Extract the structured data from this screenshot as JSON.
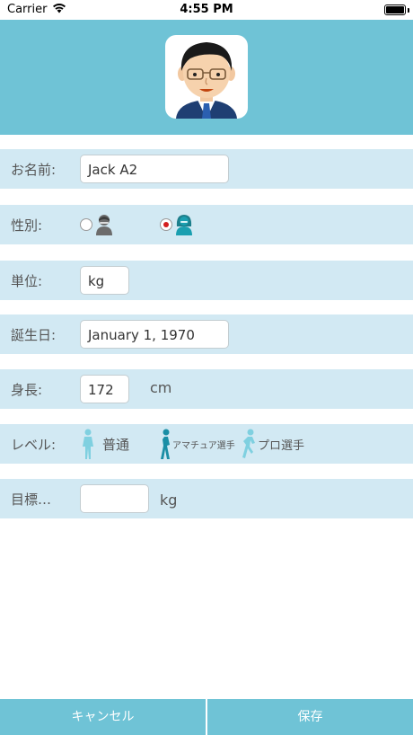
{
  "status_bar": {
    "carrier": "Carrier",
    "time": "4:55 PM"
  },
  "form": {
    "name": {
      "label": "お名前:",
      "value": "Jack A2"
    },
    "gender": {
      "label": "性別:",
      "selected": "female"
    },
    "unit": {
      "label": "単位:",
      "value": "kg"
    },
    "birthday": {
      "label": "誕生日:",
      "value": "January 1, 1970"
    },
    "height": {
      "label": "身長:",
      "value": "172",
      "unit": "cm"
    },
    "level": {
      "label": "レベル:",
      "options": [
        "普通",
        "アマチュア選手",
        "プロ選手"
      ]
    },
    "target": {
      "label": "目標…",
      "value": "",
      "unit": "kg"
    }
  },
  "buttons": {
    "cancel": "キャンセル",
    "save": "保存"
  },
  "colors": {
    "accent": "#6fc3d6",
    "row_bg": "#d2e9f3",
    "radio_selected": "#d41e1e"
  }
}
